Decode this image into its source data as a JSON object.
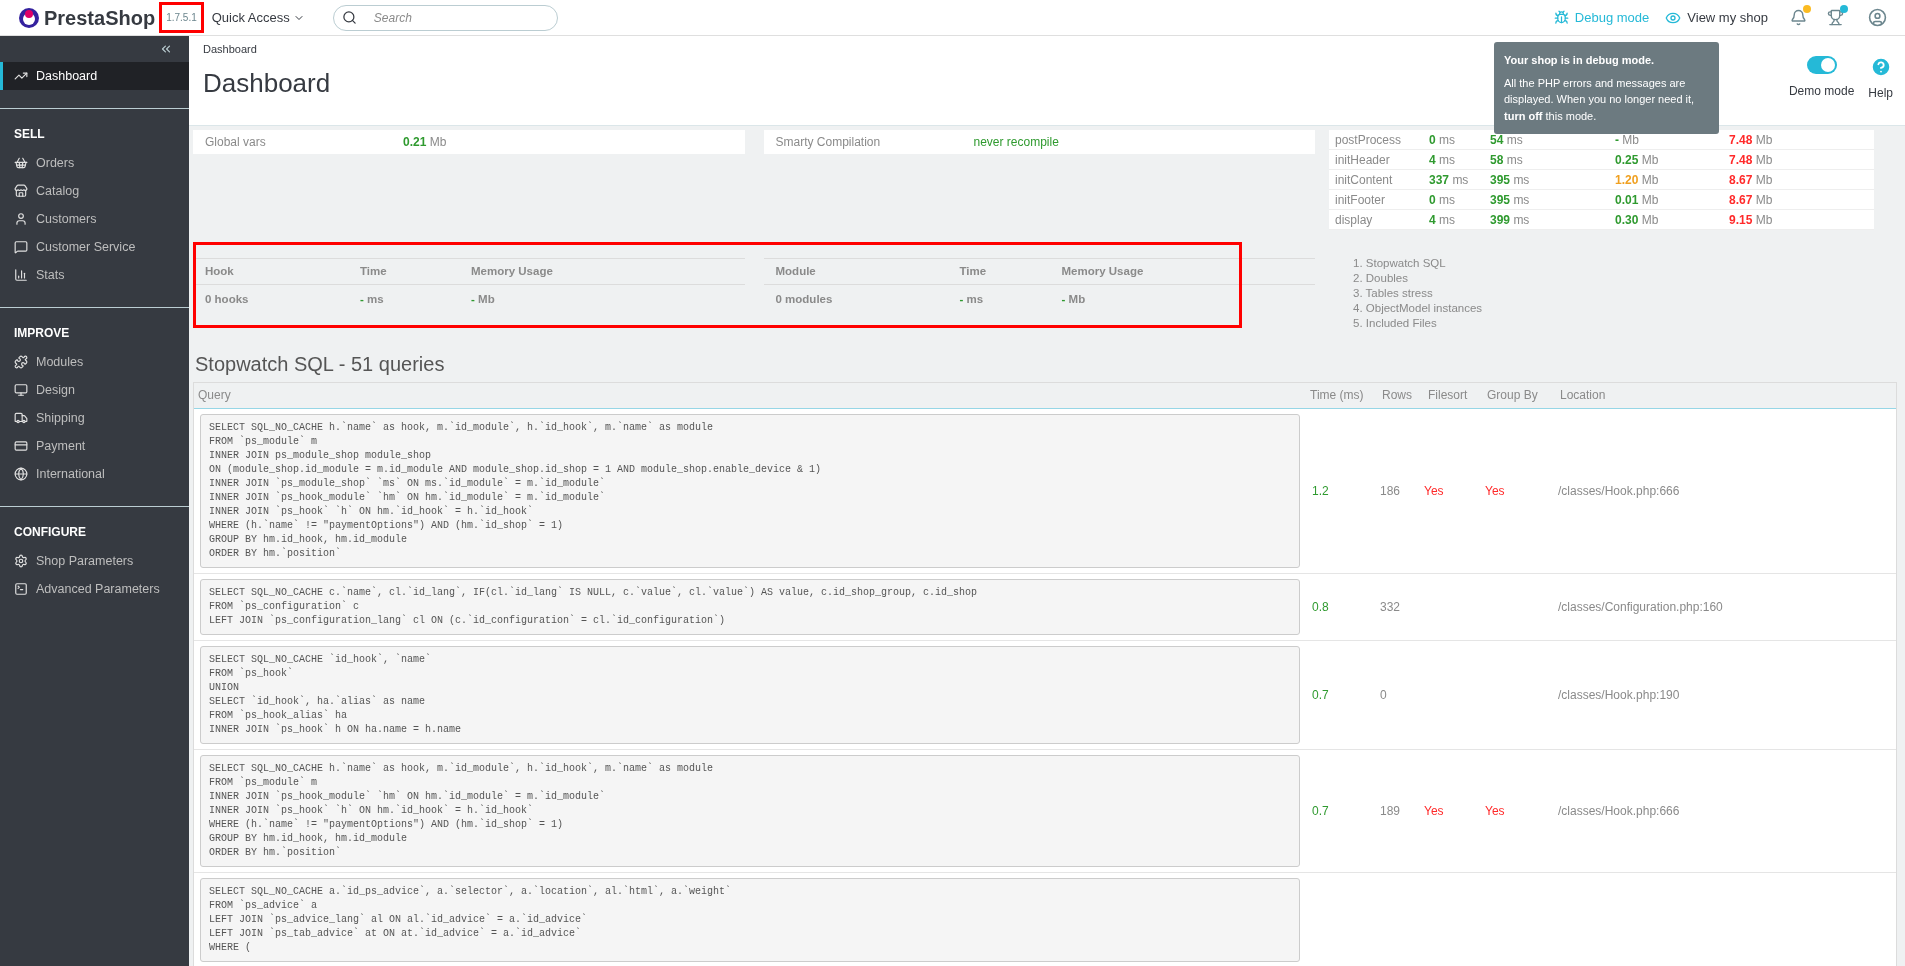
{
  "topbar": {
    "logo": "PrestaShop",
    "version": "1.7.5.1",
    "quick_access": "Quick Access",
    "search": {
      "placeholder": "Search"
    },
    "debug_mode": "Debug mode",
    "view_shop": "View my shop"
  },
  "tooltip": {
    "title": "Your shop is in debug mode.",
    "text": "All the PHP errors and messages are displayed. When you no longer need it, **turn off** this mode."
  },
  "header": {
    "breadcrumb": "Dashboard",
    "title": "Dashboard",
    "demo_mode": {
      "label": "Demo mode",
      "on": true
    },
    "help": "Help"
  },
  "sidebar": {
    "sections": [
      {
        "items": [
          {
            "label": "Dashboard",
            "selected": true
          }
        ]
      },
      {
        "heading": "SELL",
        "items": [
          {
            "label": "Orders",
            "selected": false
          },
          {
            "label": "Catalog",
            "selected": false
          },
          {
            "label": "Customers",
            "selected": false
          },
          {
            "label": "Customer Service",
            "selected": false
          },
          {
            "label": "Stats",
            "selected": false
          }
        ]
      },
      {
        "heading": "IMPROVE",
        "items": [
          {
            "label": "Modules",
            "selected": false
          },
          {
            "label": "Design",
            "selected": false
          },
          {
            "label": "Shipping",
            "selected": false
          },
          {
            "label": "Payment",
            "selected": false
          },
          {
            "label": "International",
            "selected": false
          }
        ]
      },
      {
        "heading": "CONFIGURE",
        "items": [
          {
            "label": "Shop Parameters",
            "selected": false
          },
          {
            "label": "Advanced Parameters",
            "selected": false
          }
        ]
      }
    ]
  },
  "summary": [
    {
      "label": "Global vars",
      "value": "0.21",
      "unit": "Mb"
    },
    {
      "label": "Smarty Compilation",
      "value": "never recompile"
    }
  ],
  "profile": [
    {
      "name": "postProcess",
      "cells": [
        {
          "num": "0",
          "unit": "ms",
          "color": "#2f9a2f"
        },
        {
          "num": "54",
          "unit": "ms",
          "color": "#2f9a2f"
        },
        {
          "num": "-",
          "unit": "Mb"
        },
        {
          "num": "7.48",
          "unit": "Mb",
          "color": "#ff2a2a"
        }
      ]
    },
    {
      "name": "initHeader",
      "cells": [
        {
          "num": "4",
          "unit": "ms",
          "color": "#2f9a2f"
        },
        {
          "num": "58",
          "unit": "ms",
          "color": "#2f9a2f"
        },
        {
          "num": "0.25",
          "unit": "Mb",
          "color": "#2f9a2f"
        },
        {
          "num": "7.48",
          "unit": "Mb",
          "color": "#ff2a2a"
        }
      ]
    },
    {
      "name": "initContent",
      "cells": [
        {
          "num": "337",
          "unit": "ms",
          "color": "#2f9a2f"
        },
        {
          "num": "395",
          "unit": "ms",
          "color": "#2f9a2f"
        },
        {
          "num": "1.20",
          "unit": "Mb",
          "color": "#f0a020"
        },
        {
          "num": "8.67",
          "unit": "Mb",
          "color": "#ff2a2a"
        }
      ]
    },
    {
      "name": "initFooter",
      "cells": [
        {
          "num": "0",
          "unit": "ms",
          "color": "#2f9a2f"
        },
        {
          "num": "395",
          "unit": "ms",
          "color": "#2f9a2f"
        },
        {
          "num": "0.01",
          "unit": "Mb",
          "color": "#2f9a2f"
        },
        {
          "num": "8.67",
          "unit": "Mb",
          "color": "#ff2a2a"
        }
      ]
    },
    {
      "name": "display",
      "cells": [
        {
          "num": "4",
          "unit": "ms",
          "color": "#2f9a2f"
        },
        {
          "num": "399",
          "unit": "ms",
          "color": "#2f9a2f"
        },
        {
          "num": "0.30",
          "unit": "Mb",
          "color": "#2f9a2f"
        },
        {
          "num": "9.15",
          "unit": "Mb",
          "color": "#ff2a2a"
        }
      ]
    }
  ],
  "hooks": {
    "columns": [
      "Hook",
      "Time",
      "Memory Usage"
    ],
    "row": [
      {
        "text": "0 hooks"
      },
      {
        "num": "-",
        "unit": "ms"
      },
      {
        "num": "-",
        "unit": "Mb"
      }
    ]
  },
  "modules": {
    "columns": [
      "Module",
      "Time",
      "Memory Usage"
    ],
    "row": [
      {
        "text": "0 modules"
      },
      {
        "num": "-",
        "unit": "ms"
      },
      {
        "num": "-",
        "unit": "Mb"
      }
    ]
  },
  "sections_list": [
    "1. Stopwatch SQL",
    "2. Doubles",
    "3. Tables stress",
    "4. ObjectModel instances",
    "5. Included Files"
  ],
  "sql": {
    "title": "Stopwatch SQL - 51 queries",
    "columns": [
      "Query",
      "Time (ms)",
      "Rows",
      "Filesort",
      "Group By",
      "Location"
    ],
    "rows": [
      {
        "query": [
          "SELECT SQL_NO_CACHE h.`name` as hook, m.`id_module`, h.`id_hook`, m.`name` as module",
          "FROM `ps_module` m",
          "INNER JOIN ps_module_shop module_shop",
          "ON (module_shop.id_module = m.id_module AND module_shop.id_shop = 1 AND module_shop.enable_device & 1)",
          "INNER JOIN `ps_module_shop` `ms` ON ms.`id_module` = m.`id_module`",
          "INNER JOIN `ps_hook_module` `hm` ON hm.`id_module` = m.`id_module`",
          "INNER JOIN `ps_hook` `h` ON hm.`id_hook` = h.`id_hook`",
          "WHERE (h.`name` != \"paymentOptions\") AND (hm.`id_shop` = 1)",
          "GROUP BY hm.id_hook, hm.id_module",
          "ORDER BY hm.`position`"
        ],
        "time": "1.2",
        "rows": "186",
        "filesort": "Yes",
        "group_by": "Yes",
        "location": "/classes/Hook.php:666"
      },
      {
        "query": [
          "SELECT SQL_NO_CACHE c.`name`, cl.`id_lang`, IF(cl.`id_lang` IS NULL, c.`value`, cl.`value`) AS value, c.id_shop_group, c.id_shop",
          "FROM `ps_configuration` c",
          "LEFT JOIN `ps_configuration_lang` cl ON (c.`id_configuration` = cl.`id_configuration`)"
        ],
        "time": "0.8",
        "rows": "332",
        "location": "/classes/Configuration.php:160"
      },
      {
        "query": [
          "SELECT SQL_NO_CACHE `id_hook`, `name`",
          "FROM `ps_hook`",
          "UNION",
          "SELECT `id_hook`, ha.`alias` as name",
          "FROM `ps_hook_alias` ha",
          "INNER JOIN `ps_hook` h ON ha.name = h.name"
        ],
        "time": "0.7",
        "rows": "0",
        "location": "/classes/Hook.php:190"
      },
      {
        "query": [
          "SELECT SQL_NO_CACHE h.`name` as hook, m.`id_module`, h.`id_hook`, m.`name` as module",
          "FROM `ps_module` m",
          "INNER JOIN `ps_hook_module` `hm` ON hm.`id_module` = m.`id_module`",
          "INNER JOIN `ps_hook` `h` ON hm.`id_hook` = h.`id_hook`",
          "WHERE (h.`name` != \"paymentOptions\") AND (hm.`id_shop` = 1)",
          "GROUP BY hm.id_hook, hm.id_module",
          "ORDER BY hm.`position`"
        ],
        "time": "0.7",
        "rows": "189",
        "filesort": "Yes",
        "group_by": "Yes",
        "location": "/classes/Hook.php:666"
      },
      {
        "query": [
          "SELECT SQL_NO_CACHE a.`id_ps_advice`, a.`selector`, a.`location`, al.`html`, a.`weight`",
          "FROM `ps_advice` a",
          "LEFT JOIN `ps_advice_lang` al ON al.`id_advice` = a.`id_advice`",
          "LEFT JOIN `ps_tab_advice` at ON at.`id_advice` = a.`id_advice`",
          "WHERE ("
        ]
      }
    ]
  }
}
